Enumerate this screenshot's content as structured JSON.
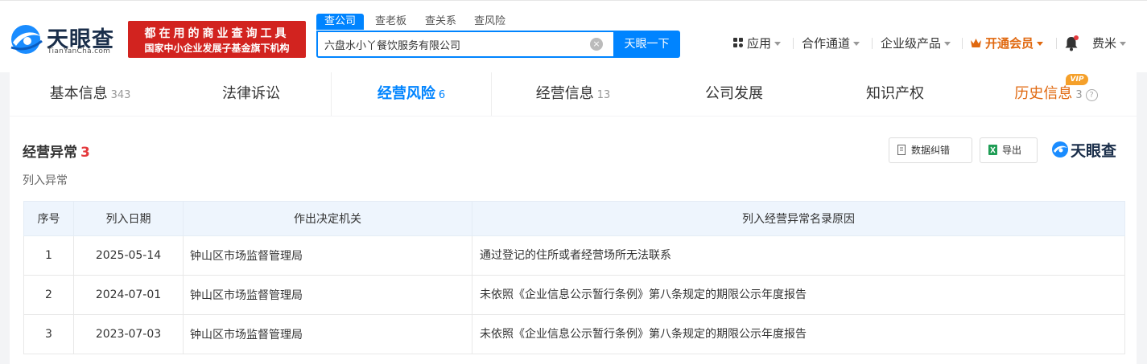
{
  "header": {
    "logo_text": "天眼查",
    "logo_sub": "TianYanCha.com",
    "slogan_line1": "都在用的商业查询工具",
    "slogan_line2": "国家中小企业发展子基金旗下机构",
    "search_tabs": [
      "查公司",
      "查老板",
      "查关系",
      "查风险"
    ],
    "search_value": "六盘水小丫餐饮服务有限公司",
    "search_button": "天眼一下",
    "nav": {
      "apps": "应用",
      "channel": "合作通道",
      "enterprise": "企业级产品",
      "vip": "开通会员",
      "user": "费米"
    },
    "colors": {
      "accent": "#0084ff",
      "vip": "#e0680f",
      "slogan_bg": "#d2231f"
    }
  },
  "tabs": [
    {
      "label": "基本信息",
      "count": "343"
    },
    {
      "label": "法律诉讼",
      "count": ""
    },
    {
      "label": "经营风险",
      "count": "6"
    },
    {
      "label": "经营信息",
      "count": "13"
    },
    {
      "label": "公司发展",
      "count": ""
    },
    {
      "label": "知识产权",
      "count": ""
    },
    {
      "label": "历史信息",
      "count": "3"
    }
  ],
  "vip_badge": "VIP",
  "section": {
    "title": "经营异常",
    "count": "3",
    "subtitle": "列入异常",
    "btn_correct": "数据纠错",
    "btn_export": "导出",
    "brand": "天眼查"
  },
  "table": {
    "headers": [
      "序号",
      "列入日期",
      "作出决定机关",
      "列入经营异常名录原因"
    ],
    "rows": [
      {
        "no": "1",
        "date": "2025-05-14",
        "org": "钟山区市场监督管理局",
        "reason": "通过登记的住所或者经营场所无法联系"
      },
      {
        "no": "2",
        "date": "2024-07-01",
        "org": "钟山区市场监督管理局",
        "reason": "未依照《企业信息公示暂行条例》第八条规定的期限公示年度报告"
      },
      {
        "no": "3",
        "date": "2023-07-03",
        "org": "钟山区市场监督管理局",
        "reason": "未依照《企业信息公示暂行条例》第八条规定的期限公示年度报告"
      }
    ]
  }
}
